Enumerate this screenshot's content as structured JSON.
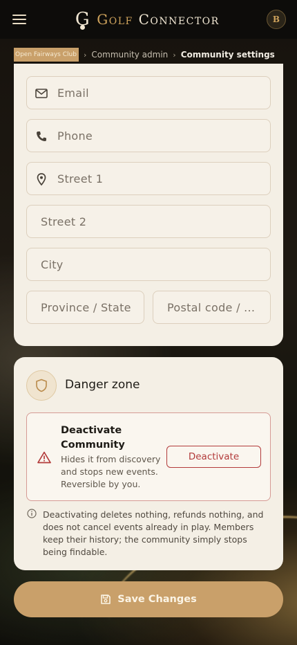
{
  "app": {
    "brand_prefix": "Golf",
    "brand_suffix": "Connector",
    "logo_letter": "G",
    "avatar_initial": "B"
  },
  "breadcrumb": {
    "club": "Open Fairways Club",
    "separator": "›",
    "admin": "Community admin",
    "current": "Community settings"
  },
  "address_form": {
    "email_placeholder": "Email",
    "phone_placeholder": "Phone",
    "street1_placeholder": "Street 1",
    "street2_placeholder": "Street 2",
    "city_placeholder": "City",
    "province_placeholder": "Province / State",
    "postal_placeholder": "Postal code / ..."
  },
  "danger_zone": {
    "title": "Danger zone",
    "deactivate_title": "Deactivate Community",
    "deactivate_desc": "Hides it from discovery and stops new events. Reversible by you.",
    "deactivate_button": "Deactivate",
    "info_text": "Deactivating deletes nothing, refunds nothing, and does not cancel events already in play. Members keep their history; the community simply stops being findable."
  },
  "actions": {
    "save_label": "Save Changes"
  },
  "colors": {
    "accent_gold": "#c9a06a",
    "danger_red": "#b23a3a",
    "card_bg": "#f4efe5",
    "topbar_bg": "#0d0c0a"
  },
  "icons": {
    "menu": "menu-icon",
    "email": "mail-icon",
    "phone": "phone-icon",
    "street": "map-pin-icon",
    "shield": "shield-icon",
    "warning": "warning-icon",
    "info": "info-icon",
    "save": "floppy-disk-icon"
  }
}
